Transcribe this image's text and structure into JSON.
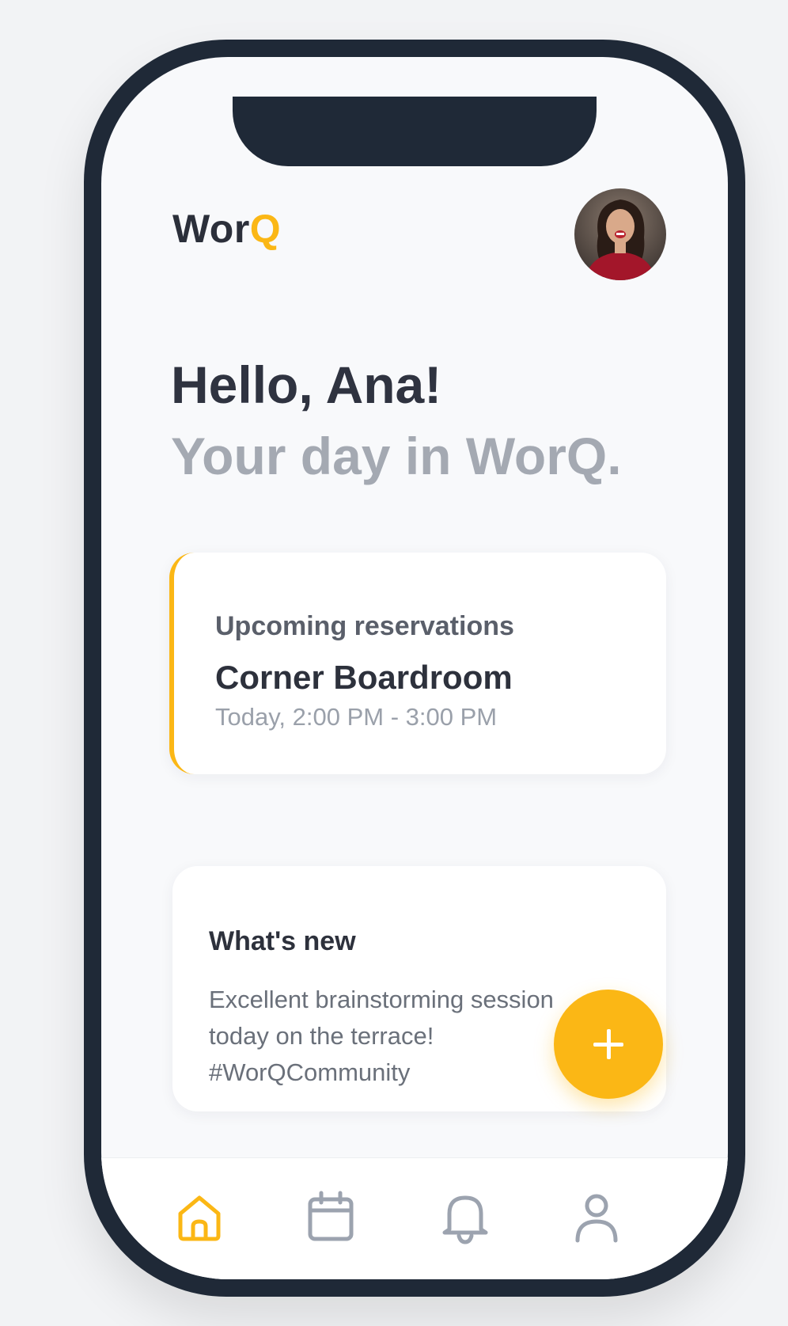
{
  "app": {
    "logo_main": "Wor",
    "logo_accent": "Q"
  },
  "header": {
    "greeting": "Hello, Ana!",
    "subgreeting": "Your day in WorQ."
  },
  "reservations": {
    "label": "Upcoming reservations",
    "room": "Corner Boardroom",
    "time": "Today, 2:00 PM - 3:00 PM"
  },
  "news": {
    "label": "What's new",
    "body": "Excellent brainstorming session today on the terrace! #WorQCommunity"
  },
  "colors": {
    "accent": "#fbb715",
    "dark": "#1f2937",
    "muted": "#a4a9b2",
    "inactive_icon": "#9ca3af"
  },
  "nav": {
    "items": [
      {
        "icon": "home-icon",
        "active": true
      },
      {
        "icon": "calendar-icon",
        "active": false
      },
      {
        "icon": "bell-icon",
        "active": false
      },
      {
        "icon": "user-icon",
        "active": false
      }
    ]
  },
  "fab": {
    "icon": "plus-icon"
  }
}
